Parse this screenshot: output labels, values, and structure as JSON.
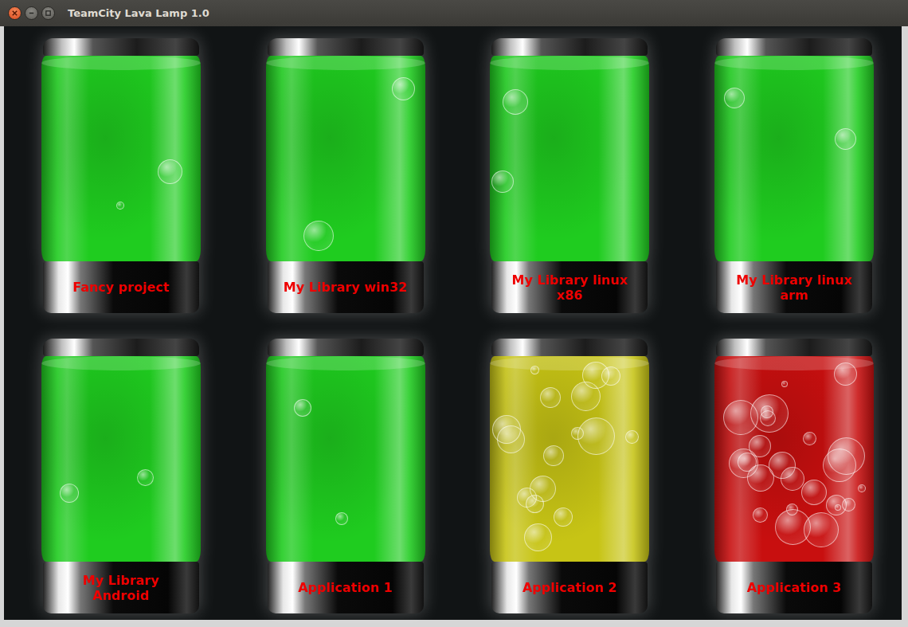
{
  "window": {
    "title": "TeamCity Lava Lamp 1.0"
  },
  "lamps": [
    {
      "name": "Fancy project",
      "kind": "success",
      "color": "#1fcc1f"
    },
    {
      "name": "My Library win32",
      "kind": "success",
      "color": "#1fcc1f"
    },
    {
      "name": "My Library linux x86",
      "kind": "success",
      "color": "#1fcc1f"
    },
    {
      "name": "My Library linux arm",
      "kind": "success",
      "color": "#1fcc1f"
    },
    {
      "name": "My Library Android",
      "kind": "success",
      "color": "#1fcc1f"
    },
    {
      "name": "Application 1",
      "kind": "success",
      "color": "#1fcc1f"
    },
    {
      "name": "Application 2",
      "kind": "running",
      "color": "#c7c415"
    },
    {
      "name": "Application 3",
      "kind": "failed",
      "color": "#c80f0f"
    }
  ]
}
